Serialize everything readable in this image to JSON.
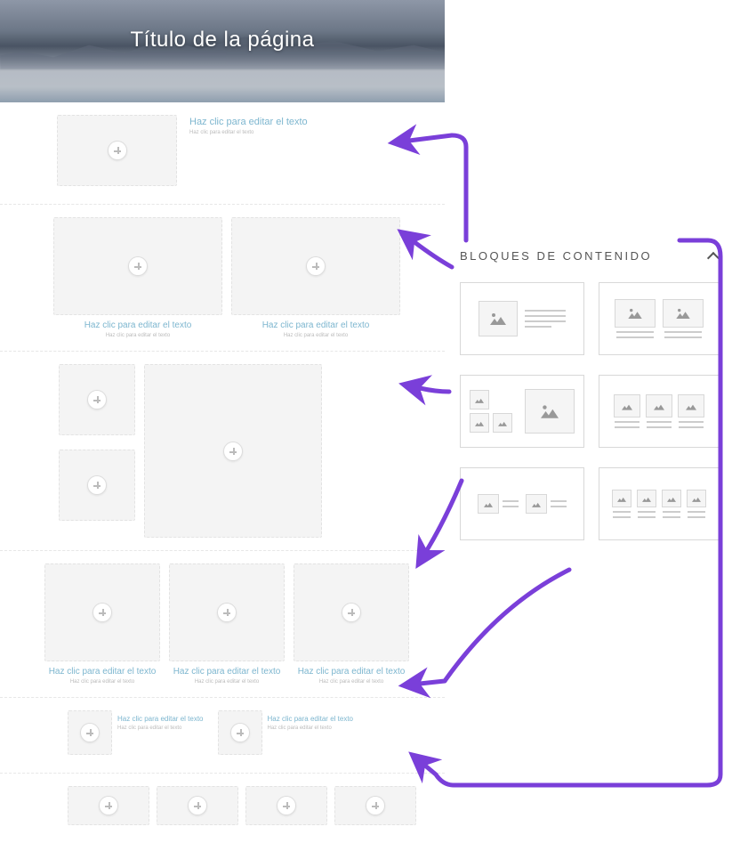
{
  "hero": {
    "title": "Título de la página"
  },
  "placeholders": {
    "title": "Haz clic para editar el texto",
    "sub": "Haz clic para editar el texto"
  },
  "panel": {
    "title": "BLOQUES DE CONTENIDO"
  }
}
